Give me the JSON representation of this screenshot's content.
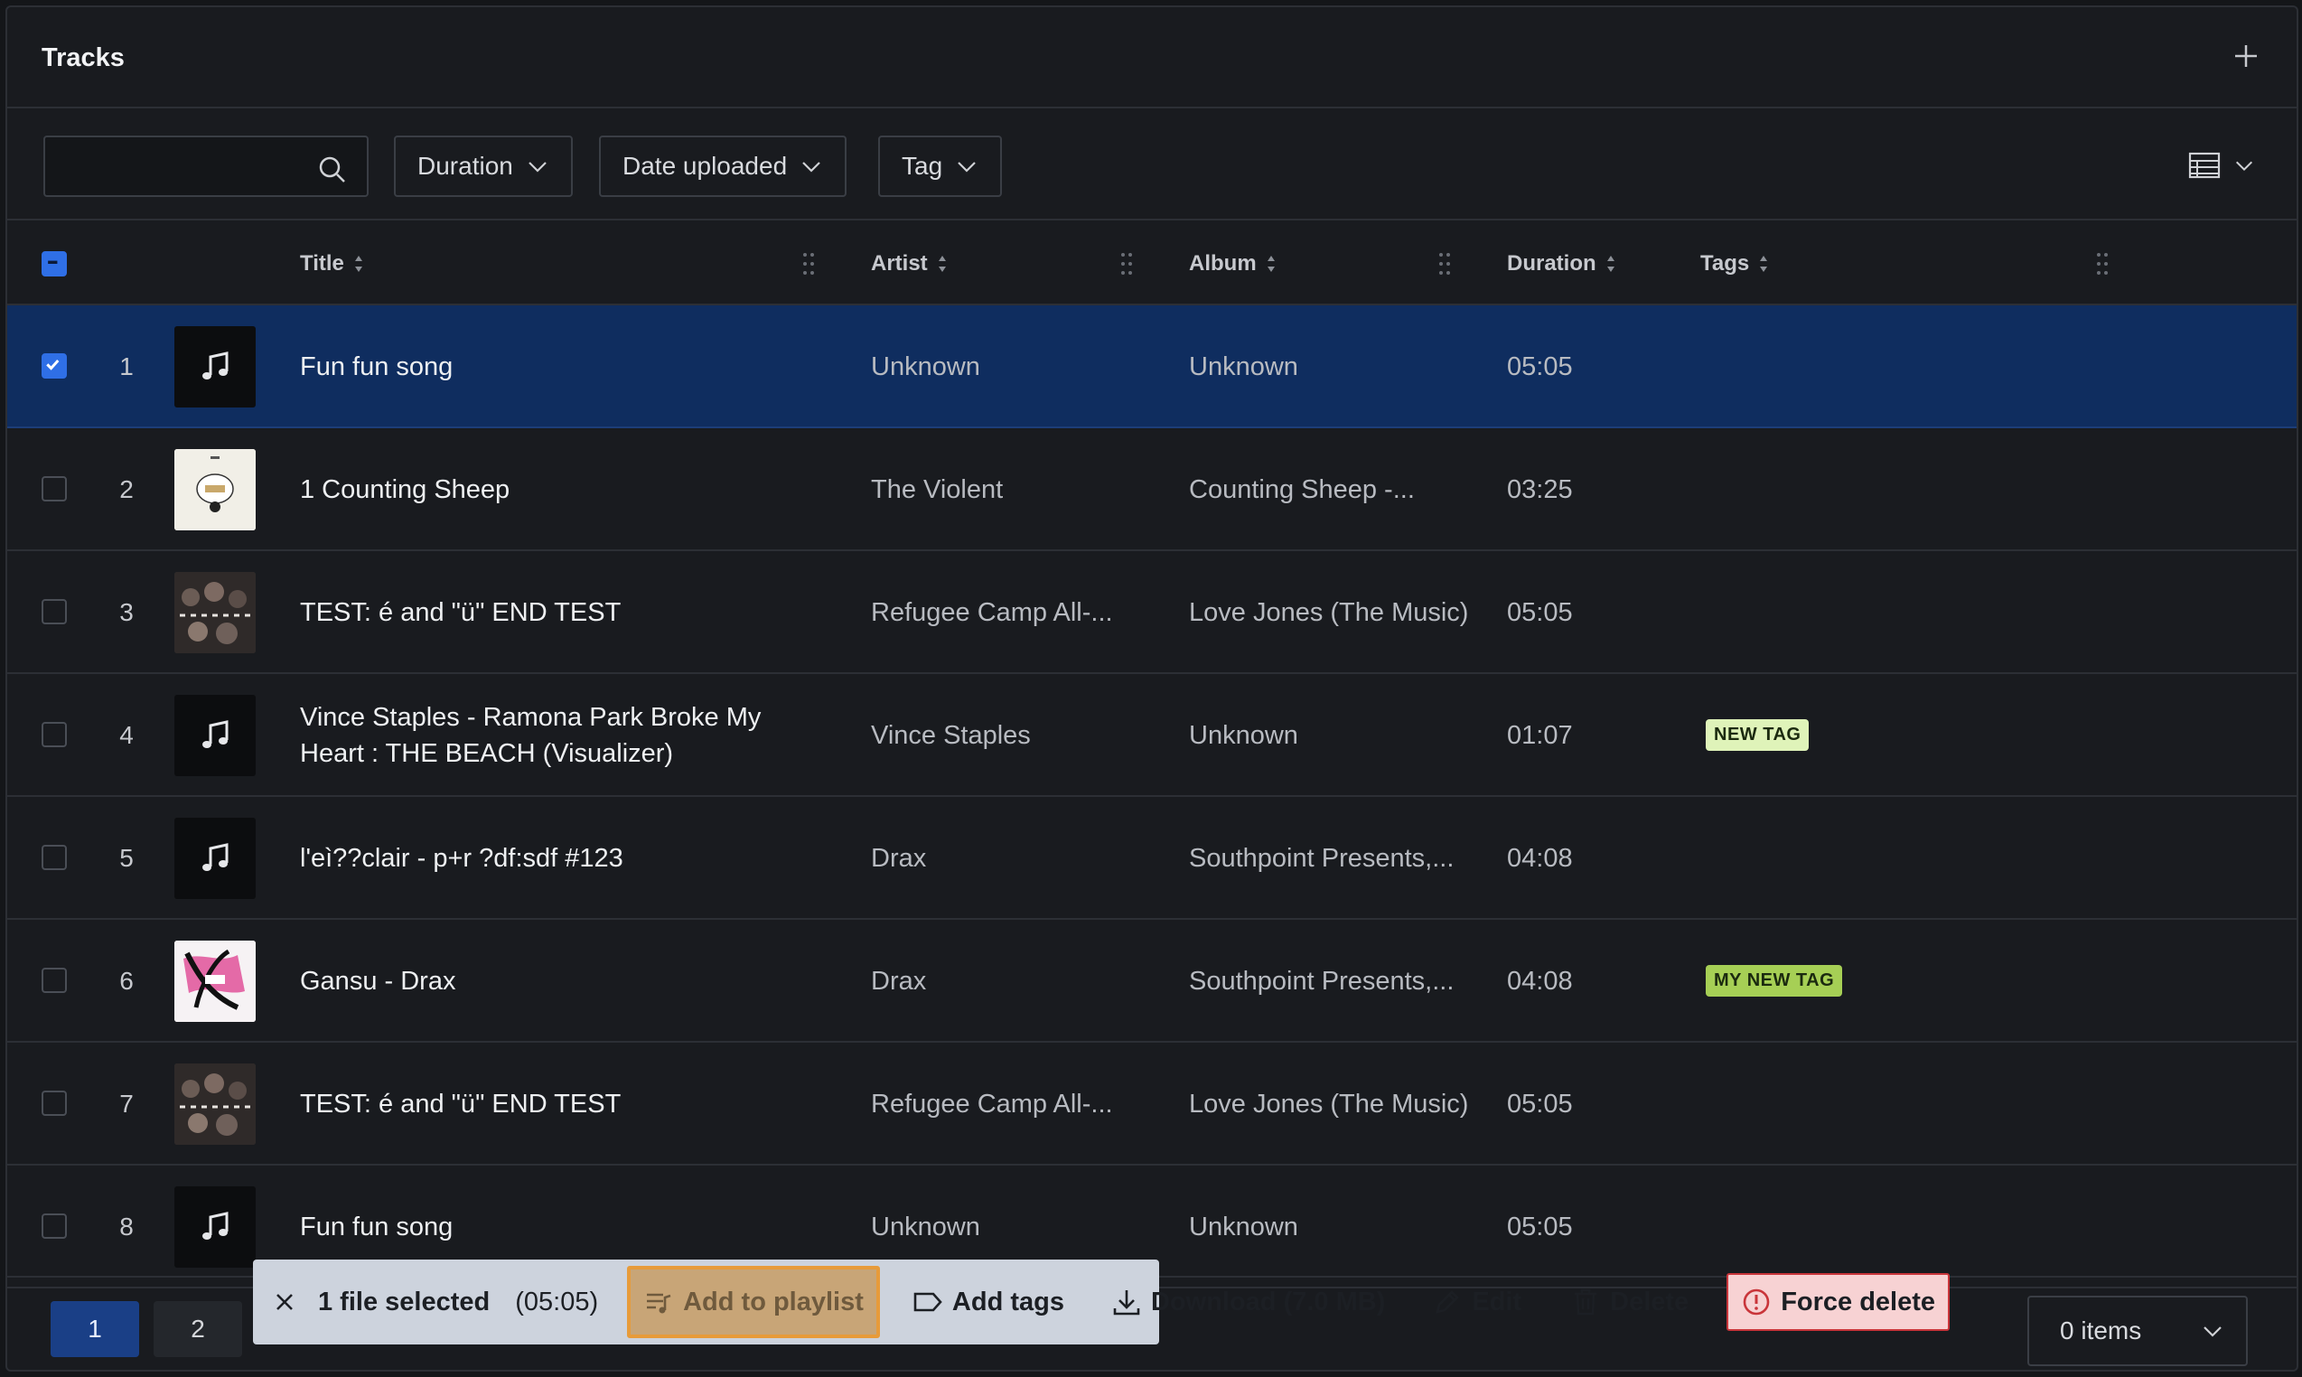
{
  "header": {
    "title": "Tracks",
    "add_icon": "plus-icon"
  },
  "filters": {
    "search_placeholder": "",
    "duration": "Duration",
    "date_uploaded": "Date uploaded",
    "tag": "Tag"
  },
  "columns": {
    "title": "Title",
    "artist": "Artist",
    "album": "Album",
    "duration": "Duration",
    "tags": "Tags"
  },
  "rows": [
    {
      "num": "1",
      "title": "Fun fun song",
      "artist": "Unknown",
      "album": "Unknown",
      "duration": "05:05",
      "tag": "",
      "thumb": "music-note-icon",
      "selected": true
    },
    {
      "num": "2",
      "title": "1 Counting Sheep",
      "artist": "The Violent",
      "album": "Counting Sheep -...",
      "duration": "03:25",
      "tag": "",
      "thumb": "album-art"
    },
    {
      "num": "3",
      "title": "TEST: é and \"ü\" END TEST",
      "artist": "Refugee Camp All-...",
      "album": "Love Jones (The Music)",
      "duration": "05:05",
      "tag": "",
      "thumb": "album-art"
    },
    {
      "num": "4",
      "title": "Vince Staples - Ramona Park Broke My Heart : THE BEACH (Visualizer)",
      "artist": "Vince Staples",
      "album": "Unknown",
      "duration": "01:07",
      "tag": "NEW TAG",
      "thumb": "music-note-icon"
    },
    {
      "num": "5",
      "title": "l'eì??clair - p+r ?df:sdf #123",
      "artist": "Drax",
      "album": "Southpoint Presents,...",
      "duration": "04:08",
      "tag": "",
      "thumb": "music-note-icon"
    },
    {
      "num": "6",
      "title": "Gansu - Drax",
      "artist": "Drax",
      "album": "Southpoint Presents,...",
      "duration": "04:08",
      "tag": "MY NEW TAG",
      "thumb": "album-art"
    },
    {
      "num": "7",
      "title": "TEST: é and \"ü\" END TEST",
      "artist": "Refugee Camp All-...",
      "album": "Love Jones (The Music)",
      "duration": "05:05",
      "tag": "",
      "thumb": "album-art"
    },
    {
      "num": "8",
      "title": "Fun fun song",
      "artist": "Unknown",
      "album": "Unknown",
      "duration": "05:05",
      "tag": "",
      "thumb": "music-note-icon"
    }
  ],
  "tag_colors": {
    "NEW TAG": "#dff3b9",
    "MY NEW TAG": "#a6cf55"
  },
  "pagination": {
    "pages": [
      "1",
      "2"
    ],
    "current": "1",
    "items_label": "0 items"
  },
  "action_bar": {
    "selected_text": "1 file selected",
    "selected_duration": "(05:05)",
    "add_to_playlist": "Add to playlist",
    "add_tags": "Add tags",
    "download": "Download (7.0 MB)",
    "edit": "Edit",
    "delete": "Delete",
    "force_delete": "Force delete"
  },
  "colors": {
    "accent": "#2f6fe6",
    "selected_row": "#0f2d5f",
    "danger": "#c9353a"
  }
}
